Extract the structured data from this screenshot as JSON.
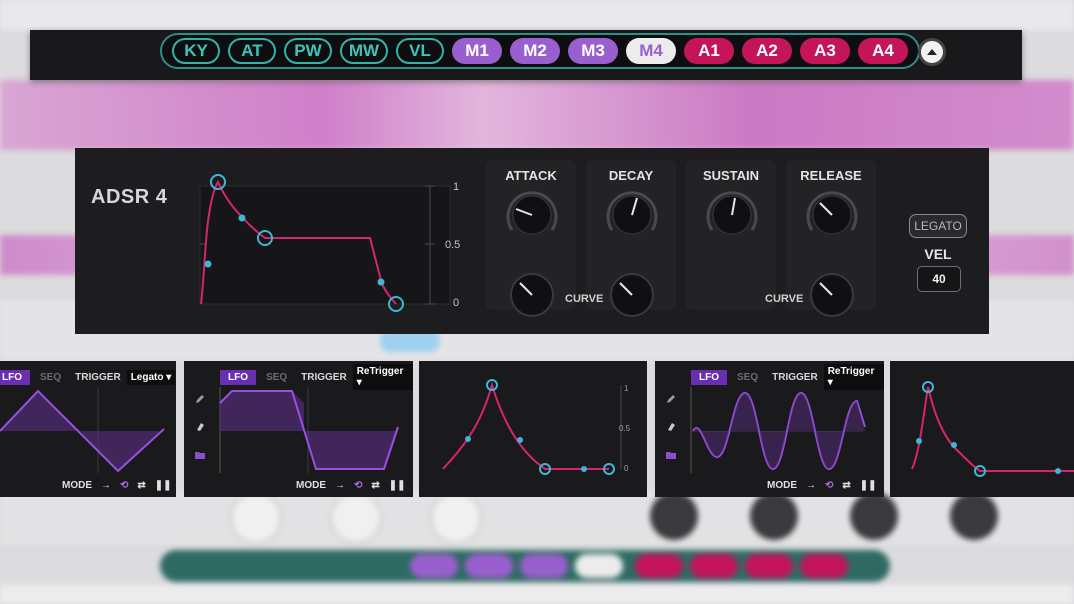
{
  "source_tabs": [
    {
      "label": "KY",
      "group": "teal"
    },
    {
      "label": "AT",
      "group": "teal"
    },
    {
      "label": "PW",
      "group": "teal"
    },
    {
      "label": "MW",
      "group": "teal"
    },
    {
      "label": "VL",
      "group": "teal"
    },
    {
      "label": "M1",
      "group": "purple"
    },
    {
      "label": "M2",
      "group": "purple"
    },
    {
      "label": "M3",
      "group": "purple"
    },
    {
      "label": "M4",
      "group": "purple",
      "selected": true
    },
    {
      "label": "A1",
      "group": "red"
    },
    {
      "label": "A2",
      "group": "red"
    },
    {
      "label": "A3",
      "group": "red"
    },
    {
      "label": "A4",
      "group": "red"
    }
  ],
  "collapse_icon": "chevron-up-icon",
  "adsr": {
    "title": "ADSR 4",
    "y_ticks": [
      "1",
      "0.5",
      "0"
    ],
    "knobs": [
      {
        "label": "ATTACK",
        "curve_label": ""
      },
      {
        "label": "DECAY",
        "curve_label": "CURVE"
      },
      {
        "label": "SUSTAIN",
        "curve_label": ""
      },
      {
        "label": "RELEASE",
        "curve_label": "CURVE"
      }
    ],
    "legato_label": "LEGATO",
    "vel_label": "VEL",
    "vel_value": "40"
  },
  "mini_panels": [
    {
      "tab_lfo": "LFO",
      "tab_seq": "SEQ",
      "trigger_label": "TRIGGER",
      "trigger_value": "Legato",
      "mode_label": "MODE"
    },
    {
      "tab_lfo": "LFO",
      "tab_seq": "SEQ",
      "trigger_label": "TRIGGER",
      "trigger_value": "ReTrigger",
      "mode_label": "MODE"
    },
    {
      "y_ticks": [
        "1",
        "0.5",
        "0"
      ]
    },
    {
      "tab_lfo": "LFO",
      "tab_seq": "SEQ",
      "trigger_label": "TRIGGER",
      "trigger_value": "ReTrigger",
      "mode_label": "MODE"
    },
    {}
  ],
  "colors": {
    "teal": "#34b3a7",
    "purple": "#9a5fce",
    "red": "#c4145a",
    "env_line": "#d6246e",
    "lfo_line": "#9a4fe0",
    "handle": "#3fb6d8"
  }
}
